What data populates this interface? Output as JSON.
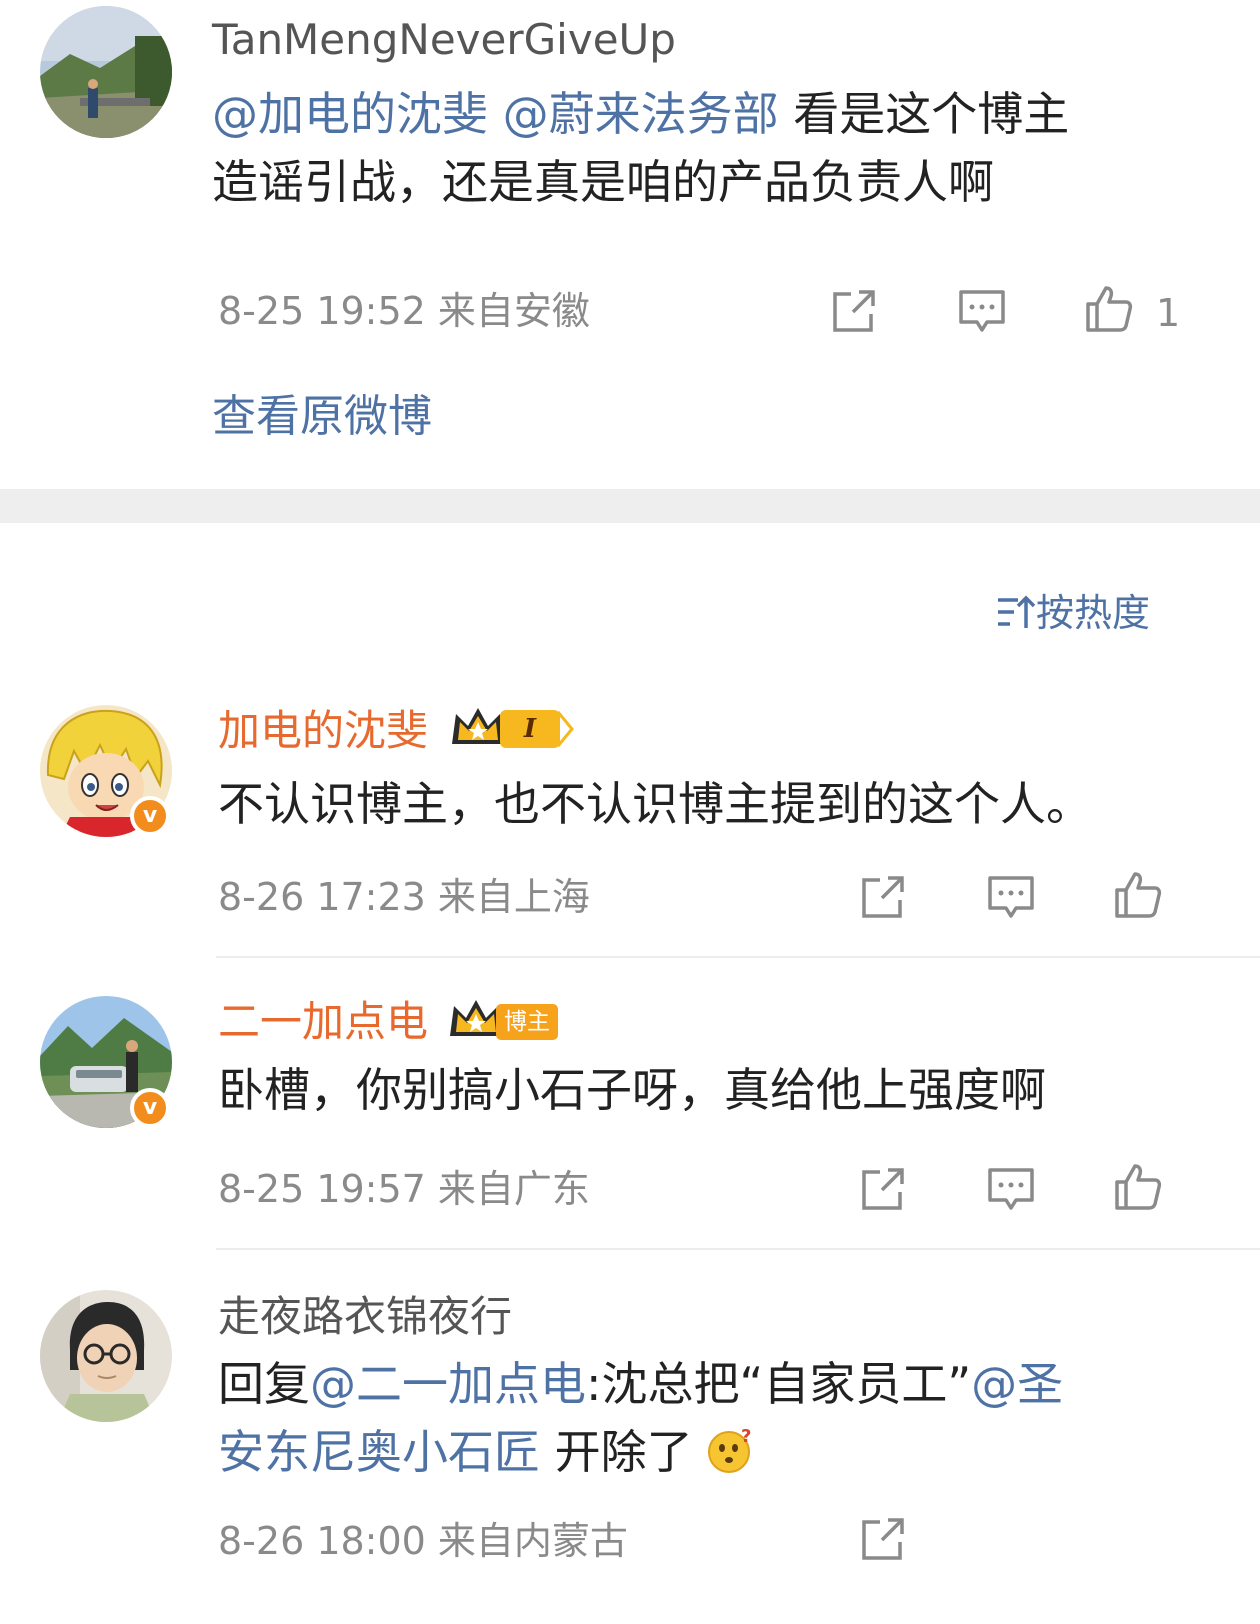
{
  "top_comment": {
    "username": "TanMengNeverGiveUp",
    "mention1": "@加电的沈斐",
    "mention2": "@蔚来法务部",
    "text_line1": "看是这个博主",
    "text_line2": "造谣引战，还是真是咱的产品负责人啊",
    "meta": "8-25 19:52  来自安徽",
    "like_count": "1",
    "view_original": "查看原微博"
  },
  "sort": {
    "label": "按热度",
    "icon": "sort-icon"
  },
  "comments": [
    {
      "username": "加电的沈斐",
      "level_badge": "I",
      "text": "不认识博主，也不认识博主提到的这个人。",
      "meta": "8-26 17:23  来自上海"
    },
    {
      "username": "二一加点电",
      "role_badge": "博主",
      "text": "卧槽，你别搞小石子呀，真给他上强度啊",
      "meta": "8-25 19:57  来自广东"
    },
    {
      "username": "走夜路衣锦夜行",
      "reply_prefix": "回复",
      "reply_mention": "@二一加点电",
      "reply_text": ":沈总把“自家员工”",
      "mention_line1": "@圣",
      "mention_line2": "安东尼奥小石匠",
      "text_end": " 开除了",
      "meta": "8-26 18:00  来自内蒙古"
    }
  ],
  "icons": [
    "share-icon",
    "comment-icon",
    "like-icon",
    "verified-icon",
    "crown-icon",
    "emoji-surprised-icon"
  ],
  "colors": {
    "link": "#4f72a5",
    "vip_name": "#e8692e",
    "meta": "#8a8a8a",
    "verified": "#f28c1c"
  }
}
